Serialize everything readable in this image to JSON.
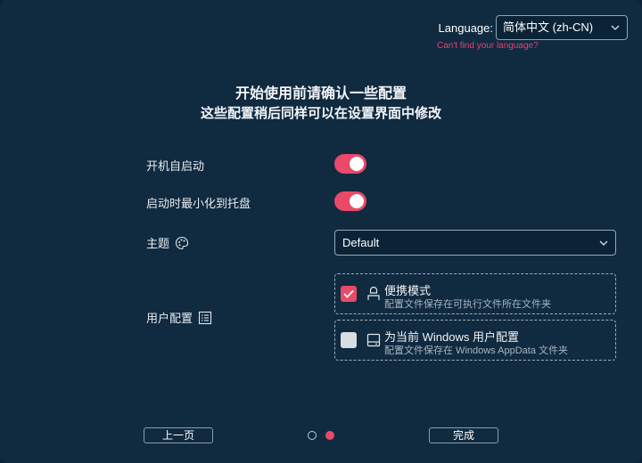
{
  "language": {
    "label": "Language:",
    "selected": "简体中文 (zh-CN)",
    "hint": "Can't find your language?"
  },
  "header": {
    "title": "开始使用前请确认一些配置",
    "subtitle": "这些配置稍后同样可以在设置界面中修改"
  },
  "settings": {
    "autostart": {
      "label": "开机自启动",
      "enabled": true
    },
    "minimize_to_tray": {
      "label": "启动时最小化到托盘",
      "enabled": true
    },
    "theme": {
      "label": "主题",
      "value": "Default"
    },
    "profile": {
      "label": "用户配置",
      "options": [
        {
          "title": "便携模式",
          "desc": "配置文件保存在可执行文件所在文件夹",
          "checked": true
        },
        {
          "title": "为当前 Windows 用户配置",
          "desc": "配置文件保存在 Windows AppData 文件夹",
          "checked": false
        }
      ]
    }
  },
  "footer": {
    "prev_label": "上一页",
    "finish_label": "完成",
    "page_count": 2,
    "current_page": 2
  },
  "colors": {
    "background": "#102a40",
    "accent": "#e94a68"
  }
}
